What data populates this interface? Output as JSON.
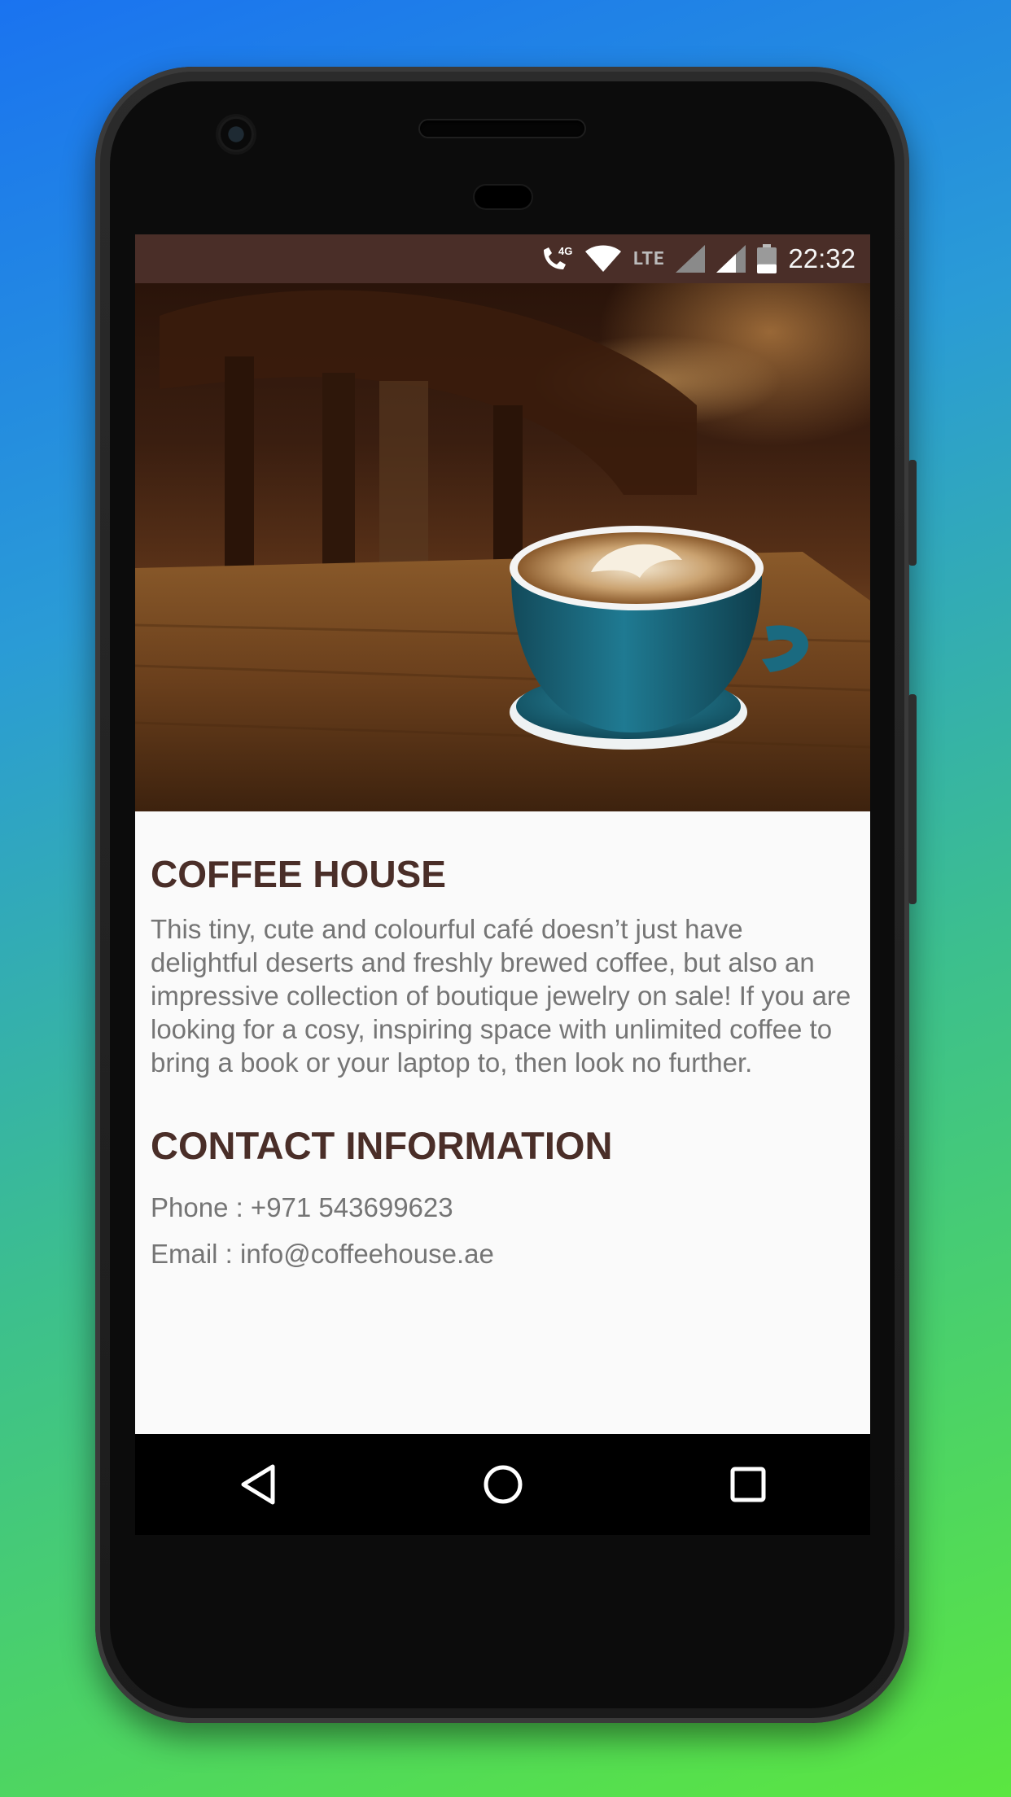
{
  "status_bar": {
    "time": "22:32",
    "icons": [
      "phone-4g-icon",
      "wifi-icon",
      "lte-label",
      "signal-icon",
      "signal-icon",
      "battery-icon"
    ],
    "lte_text": "LTE",
    "network_text": "4G",
    "battery_level": 0.35,
    "background_color": "#4a2e28"
  },
  "hero": {
    "image": "coffee-latte-photo"
  },
  "cafe": {
    "title": "COFFEE HOUSE",
    "description": "This tiny, cute and colourful café doesn’t just have delightful deserts and freshly brewed coffee, but also an impressive collection of boutique jewelry on sale! If you are looking for a cosy, inspiring space with unlimited coffee to bring a book or your laptop to, then look no further."
  },
  "contact": {
    "heading": "CONTACT INFORMATION",
    "phone": "Phone : +971 543699623",
    "email": "Email : info@coffeehouse.ae"
  },
  "nav_bar": {
    "buttons": [
      "back-icon",
      "home-icon",
      "recents-icon"
    ]
  },
  "colors": {
    "heading": "#4a2e28",
    "body_text": "#757575",
    "screen_bg": "#fafafa",
    "cup": "#1e6c82"
  }
}
